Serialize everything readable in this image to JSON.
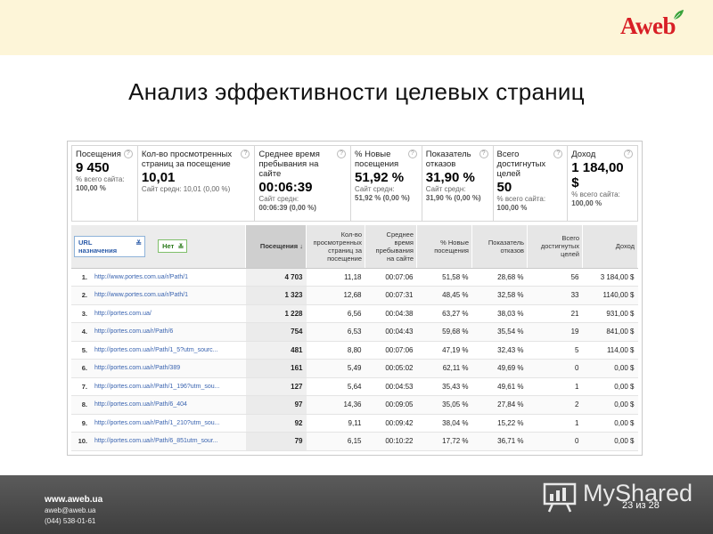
{
  "header": {
    "logo_text": "Aweb",
    "title": "Анализ эффективности целевых страниц"
  },
  "summary": [
    {
      "label": "Посещения",
      "value": "9 450",
      "sub1": "% всего сайта:",
      "sub2": "100,00 %"
    },
    {
      "label": "Кол-во просмотренных страниц за посещение",
      "value": "10,01",
      "sub1": "Сайт средн: 10,01 (0,00 %)",
      "sub2": ""
    },
    {
      "label": "Среднее время пребывания на сайте",
      "value": "00:06:39",
      "sub1": "Сайт средн:",
      "sub2": "00:06:39 (0,00 %)"
    },
    {
      "label": "% Новые посещения",
      "value": "51,92 %",
      "sub1": "Сайт средн:",
      "sub2": "51,92 % (0,00 %)"
    },
    {
      "label": "Показатель отказов",
      "value": "31,90 %",
      "sub1": "Сайт средн:",
      "sub2": "31,90 % (0,00 %)"
    },
    {
      "label": "Всего достигнутых целей",
      "value": "50",
      "sub1": "% всего сайта:",
      "sub2": "100,00 %"
    },
    {
      "label": "Доход",
      "value": "1 184,00 $",
      "sub1": "% всего сайта:",
      "sub2": "100,00 %"
    }
  ],
  "table": {
    "filter_primary": "URL назначения",
    "filter_secondary": "Нет",
    "headers": {
      "visits": "Посещения ↓",
      "pages": "Кол-во просмотренных страниц за посещение",
      "time": "Среднее время пребывания на сайте",
      "new": "% Новые посещения",
      "bounce": "Показатель отказов",
      "goals": "Всего достигнутых целей",
      "revenue": "Доход"
    },
    "rows": [
      {
        "n": "1.",
        "url": "http://www.portes.com.ua/r/Path/1",
        "visits": "4 703",
        "pages": "11,18",
        "time": "00:07:06",
        "new": "51,58 %",
        "bounce": "28,68 %",
        "goals": "56",
        "revenue": "3 184,00 $"
      },
      {
        "n": "2.",
        "url": "http://www.portes.com.ua/r/Path/1",
        "visits": "1 323",
        "pages": "12,68",
        "time": "00:07:31",
        "new": "48,45 %",
        "bounce": "32,58 %",
        "goals": "33",
        "revenue": "1140,00 $"
      },
      {
        "n": "3.",
        "url": "http://portes.com.ua/",
        "visits": "1 228",
        "pages": "6,56",
        "time": "00:04:38",
        "new": "63,27 %",
        "bounce": "38,03 %",
        "goals": "21",
        "revenue": "931,00 $"
      },
      {
        "n": "4.",
        "url": "http://portes.com.ua/r/Path/6",
        "visits": "754",
        "pages": "6,53",
        "time": "00:04:43",
        "new": "59,68 %",
        "bounce": "35,54 %",
        "goals": "19",
        "revenue": "841,00 $"
      },
      {
        "n": "5.",
        "url": "http://portes.com.ua/r/Path/1_5?utm_sourc...",
        "visits": "481",
        "pages": "8,80",
        "time": "00:07:06",
        "new": "47,19 %",
        "bounce": "32,43 %",
        "goals": "5",
        "revenue": "114,00 $"
      },
      {
        "n": "6.",
        "url": "http://portes.com.ua/r/Path/389",
        "visits": "161",
        "pages": "5,49",
        "time": "00:05:02",
        "new": "62,11 %",
        "bounce": "49,69 %",
        "goals": "0",
        "revenue": "0,00 $"
      },
      {
        "n": "7.",
        "url": "http://portes.com.ua/r/Path/1_196?utm_sou...",
        "visits": "127",
        "pages": "5,64",
        "time": "00:04:53",
        "new": "35,43 %",
        "bounce": "49,61 %",
        "goals": "1",
        "revenue": "0,00 $"
      },
      {
        "n": "8.",
        "url": "http://portes.com.ua/r/Path/6_404",
        "visits": "97",
        "pages": "14,36",
        "time": "00:09:05",
        "new": "35,05 %",
        "bounce": "27,84 %",
        "goals": "2",
        "revenue": "0,00 $"
      },
      {
        "n": "9.",
        "url": "http://portes.com.ua/r/Path/1_210?utm_sou...",
        "visits": "92",
        "pages": "9,11",
        "time": "00:09:42",
        "new": "38,04 %",
        "bounce": "15,22 %",
        "goals": "1",
        "revenue": "0,00 $"
      },
      {
        "n": "10.",
        "url": "http://portes.com.ua/r/Path/6_851utm_sour...",
        "visits": "79",
        "pages": "6,15",
        "time": "00:10:22",
        "new": "17,72 %",
        "bounce": "36,71 %",
        "goals": "0",
        "revenue": "0,00 $"
      }
    ]
  },
  "footer": {
    "site": "www.aweb.ua",
    "email": "aweb@aweb.ua",
    "phone": "(044) 538-01-61",
    "brand": "MyShared",
    "page_current": "23",
    "page_sep": "из",
    "page_total": "28"
  }
}
